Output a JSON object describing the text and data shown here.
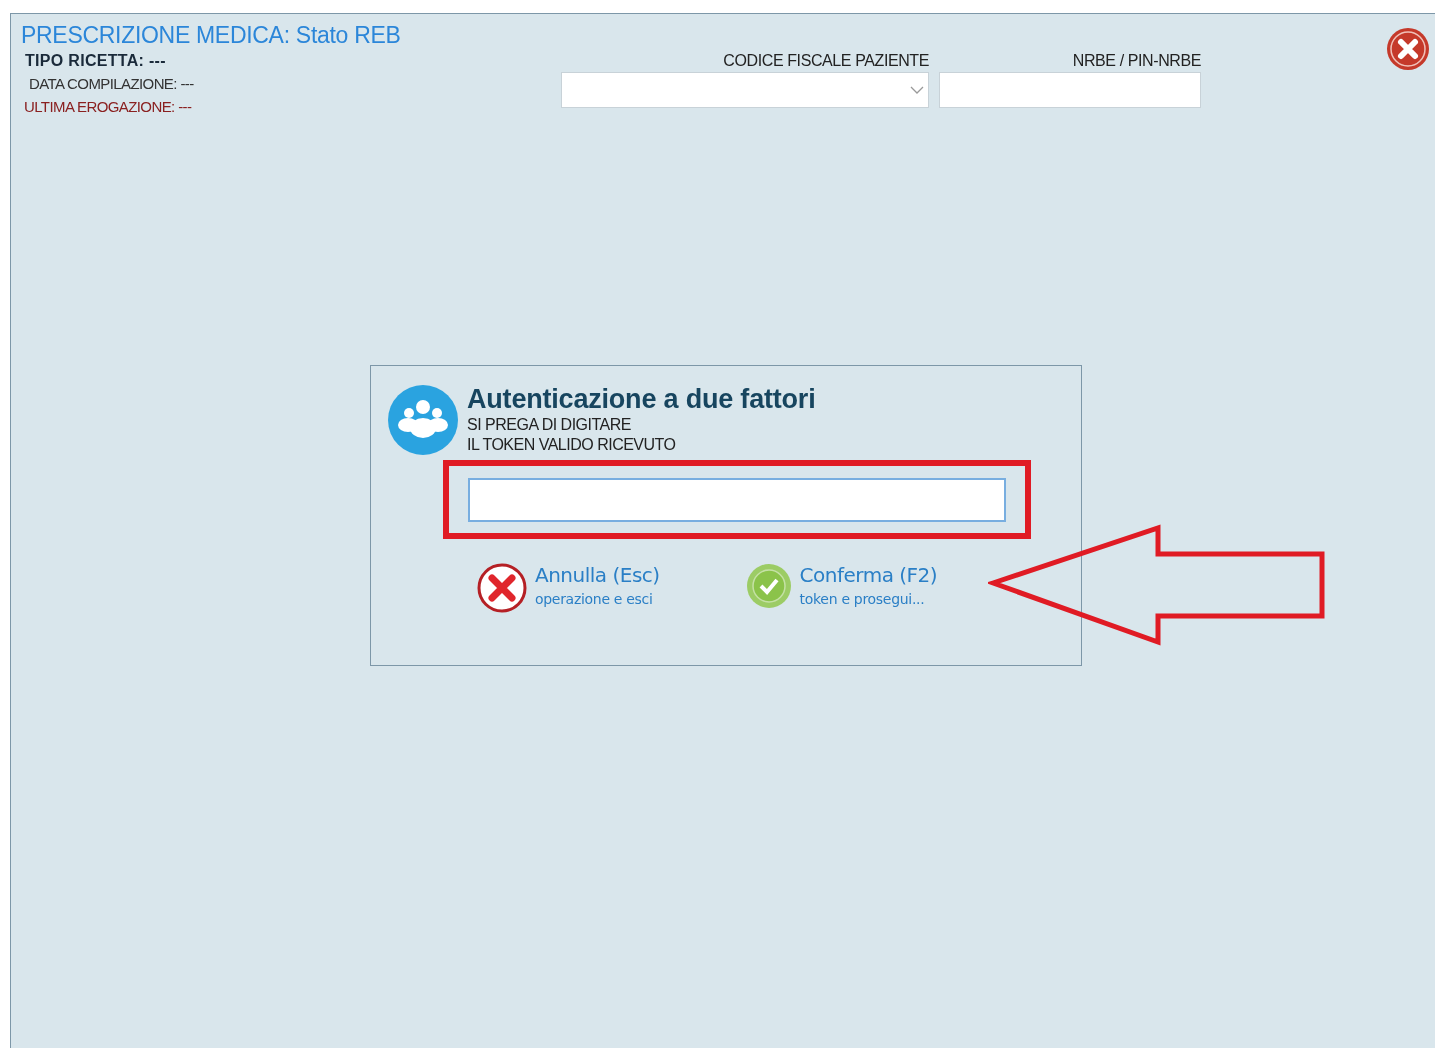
{
  "window": {
    "title": "PRESCRIZIONE MEDICA: Stato REB"
  },
  "info": [
    {
      "kind": "type",
      "text": "TIPO RICETTA: ---"
    },
    {
      "kind": "plain",
      "text": "DATA COMPILAZIONE: ---"
    },
    {
      "kind": "alert",
      "text": "ULTIMA EROGAZIONE: ---"
    }
  ],
  "fields": [
    {
      "kind": "dropdown",
      "label": "CODICE FISCALE PAZIENTE"
    },
    {
      "kind": "text",
      "label": "NRBE / PIN-NRBE"
    }
  ],
  "dialog": {
    "title": "Autenticazione a due fattori",
    "message": [
      "SI PREGA DI DIGITARE",
      "IL TOKEN VALIDO RICEVUTO"
    ],
    "token_focused": true,
    "buttons": [
      {
        "kind": "cancel",
        "label": "Annulla (Esc)",
        "sublabel": "operazione e esci"
      },
      {
        "kind": "confirm",
        "label": "Conferma (F2)",
        "sublabel": "token e prosegui..."
      }
    ]
  }
}
